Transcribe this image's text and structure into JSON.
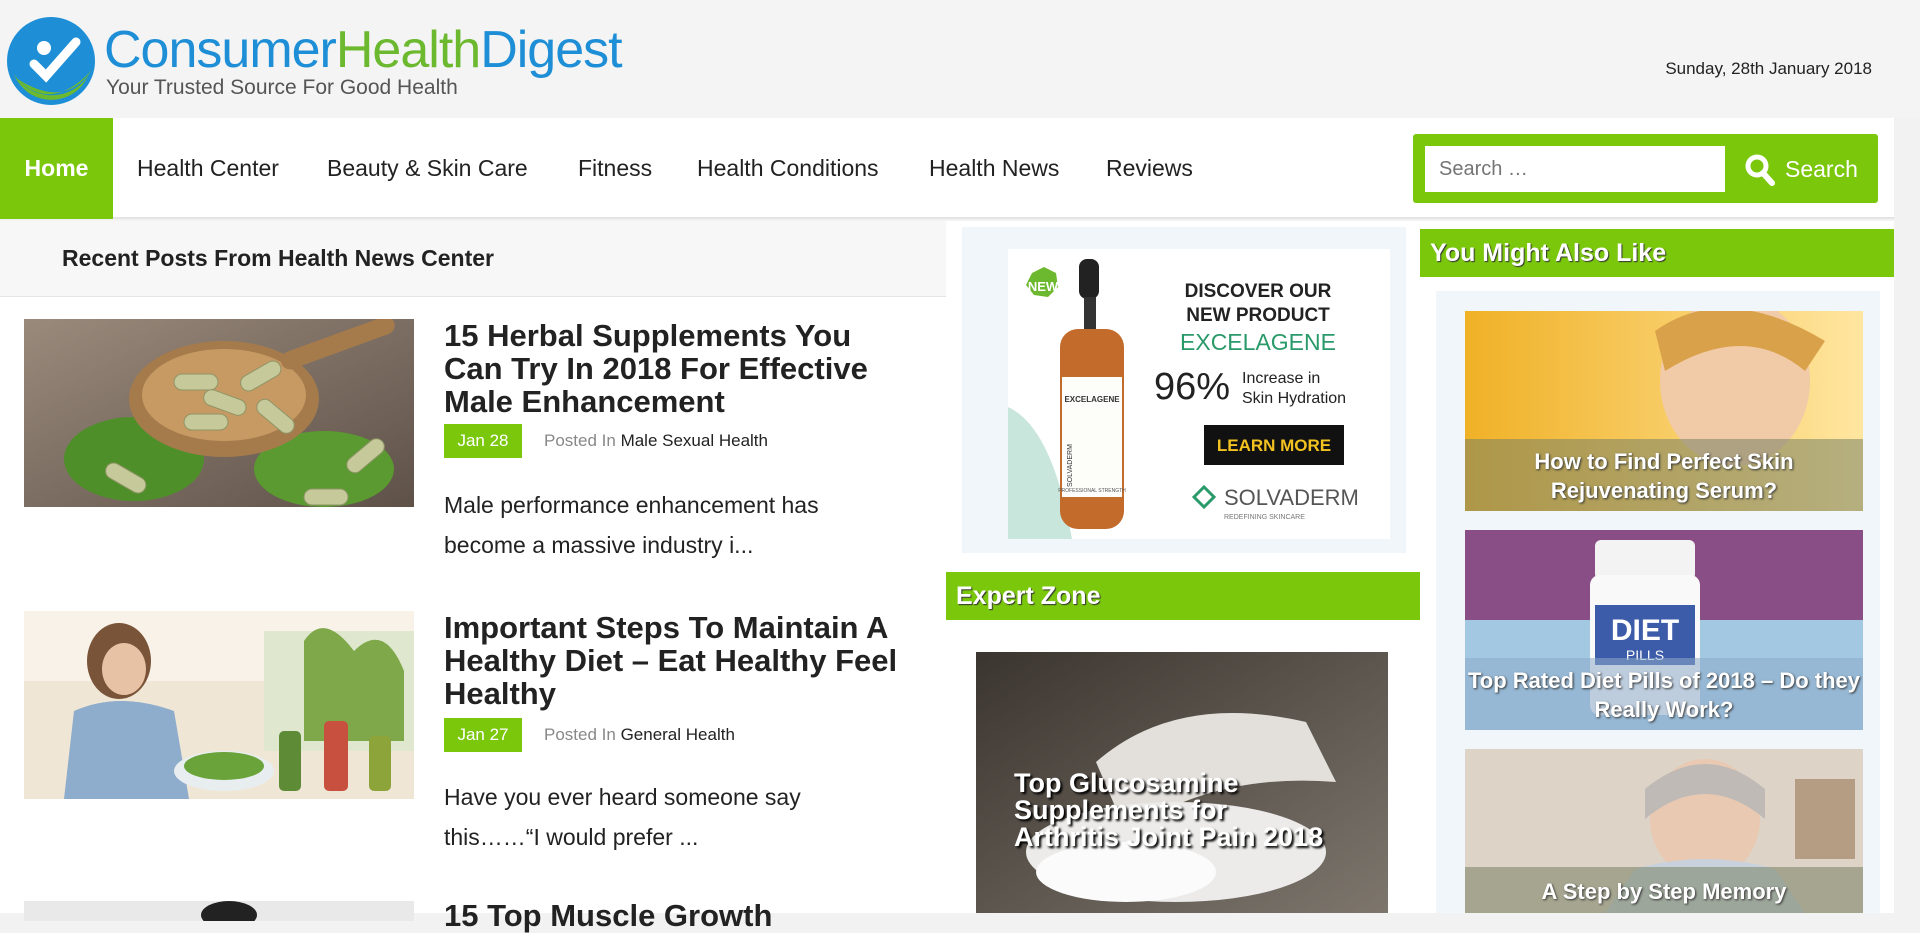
{
  "logo": {
    "part1": "Consumer",
    "part2": "Health",
    "part3": "Digest",
    "tagline": "Your Trusted Source For Good Health"
  },
  "date": "Sunday, 28th January 2018",
  "nav": {
    "home": "Home",
    "items": [
      "Health Center",
      "Beauty & Skin Care",
      "Fitness",
      "Health Conditions",
      "Health News",
      "Reviews"
    ]
  },
  "search": {
    "placeholder": "Search …",
    "button": "Search"
  },
  "main": {
    "section_title": "Recent Posts From Health News Center",
    "posted_in": "Posted In",
    "posts": [
      {
        "title": "15 Herbal Supplements You Can Try In 2018 For Effective Male Enhancement",
        "date": "Jan 28",
        "category": "Male Sexual Health",
        "excerpt": "Male performance enhancement has become a massive industry i..."
      },
      {
        "title": "Important Steps To Maintain A Healthy Diet – Eat Healthy Feel Healthy",
        "date": "Jan 27",
        "category": "General Health",
        "excerpt": "Have you ever heard someone say this……“I would prefer ..."
      },
      {
        "title": "15 Top Muscle Growth"
      }
    ]
  },
  "ad": {
    "badge": "NEW",
    "line1": "DISCOVER OUR",
    "line2": "NEW PRODUCT",
    "product": "EXCELAGENE",
    "percent": "96%",
    "claim1": "Increase in",
    "claim2": "Skin Hydration",
    "cta": "LEARN MORE",
    "brand": "SOLVADERM",
    "brand_sub": "REDEFINING SKINCARE",
    "bottle_label": "EXCELAGENE",
    "bottle_side": "SOLVADERM",
    "bottle_footer": "PROFESSIONAL STRENGTH"
  },
  "expert": {
    "title": "Expert Zone",
    "caption": "Top Glucosamine Supplements for Arthritis Joint Pain 2018"
  },
  "sidebar": {
    "title": "You Might Also Like",
    "items": [
      {
        "caption": "How to Find Perfect Skin Rejuvenating Serum?"
      },
      {
        "caption": "Top Rated Diet Pills of 2018 – Do they Really Work?",
        "jar_text": "DIET",
        "jar_sub": "PILLS"
      },
      {
        "caption": "A Step by Step Memory"
      }
    ]
  },
  "colors": {
    "accent": "#7ac70c",
    "logo_blue": "#1e8fd6",
    "logo_green": "#6cb82f"
  }
}
